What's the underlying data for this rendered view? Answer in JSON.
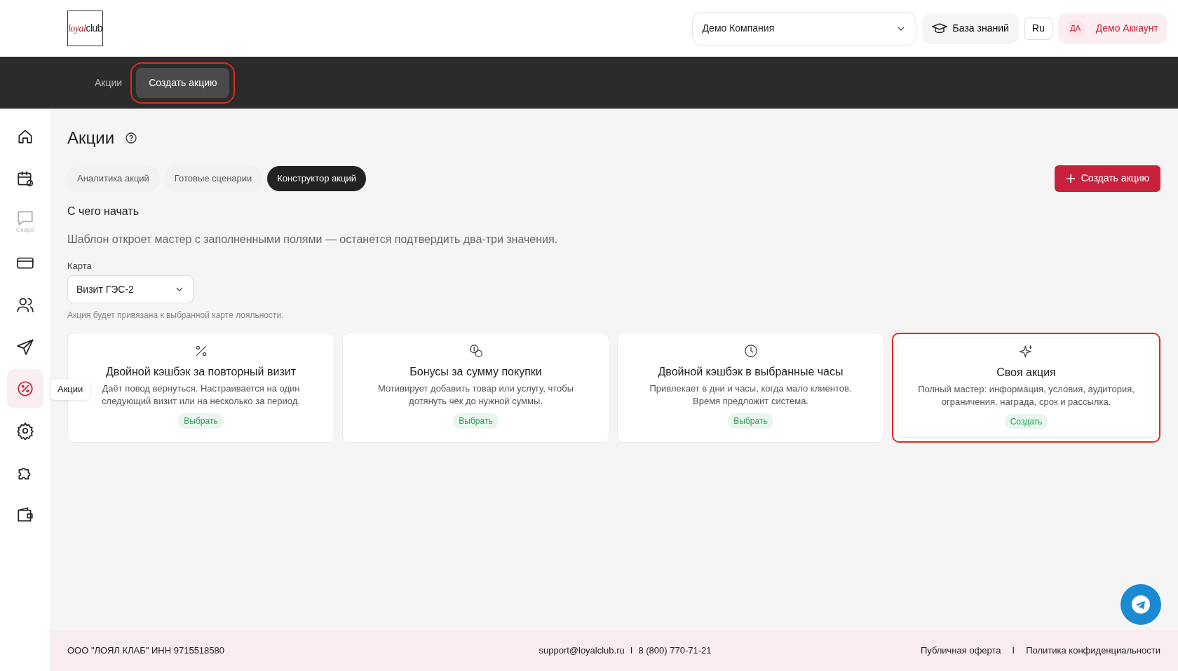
{
  "header": {
    "logo": {
      "accent": "loyal",
      "rest": "club"
    },
    "company_select": {
      "value": "Демо Компания"
    },
    "knowledge_base": "База знаний",
    "language": "Ru",
    "account": {
      "initials": "ДА",
      "name": "Демо Аккаунт"
    }
  },
  "subnav": [
    {
      "label": "Акции",
      "selected": false,
      "highlighted": false
    },
    {
      "label": "Создать акцию",
      "selected": true,
      "highlighted": true
    }
  ],
  "sidebar": {
    "items": [
      {
        "selected": false
      },
      {
        "selected": false
      },
      {
        "selected": false,
        "caption": "Скоро",
        "disabled": true
      },
      {
        "selected": false
      },
      {
        "selected": false
      },
      {
        "selected": false
      },
      {
        "selected": true
      },
      {
        "selected": false
      },
      {
        "selected": false
      },
      {
        "selected": false
      }
    ],
    "tooltip": "Акции"
  },
  "page": {
    "title": "Акции",
    "tabs": [
      {
        "label": "Аналитика акций",
        "selected": false
      },
      {
        "label": "Готовые сценарии",
        "selected": false
      },
      {
        "label": "Конструктор акций",
        "selected": true
      }
    ],
    "create_button": "Создать акцию",
    "section_title": "С чего начать",
    "description": "Шаблон откроет мастер с заполненными полями — останется подтвердить два-три значения.",
    "card_select": {
      "label": "Карта",
      "value": "Визит ГЭС-2",
      "hint": "Акция будет привязана к выбранной карте лояльности."
    },
    "templates": [
      {
        "title": "Двойной кэшбэк за повторный визит",
        "description": "Даёт повод вернуться. Настраивается на один следующий визит или на несколько за период.",
        "action": "Выбрать",
        "highlighted": false
      },
      {
        "title": "Бонусы за сумму покупки",
        "description": "Мотивирует добавить товар или услугу, чтобы дотянуть чек до нужной суммы.",
        "action": "Выбрать",
        "highlighted": false
      },
      {
        "title": "Двойной кэшбэк в выбранные часы",
        "description": "Привлекает в дни и часы, когда мало клиентов. Время предложит система.",
        "action": "Выбрать",
        "highlighted": false
      },
      {
        "title": "Своя акция",
        "description": "Полный мастер: информация, условия, аудитория, ограничения, награда, срок и рассылка.",
        "action": "Создать",
        "highlighted": true
      }
    ]
  },
  "footer": {
    "company": "ООО \"ЛОЯЛ КЛАБ\" ИНН 9715518580",
    "email": "support@loyalclub.ru",
    "separator_1": "I",
    "phone": "8 (800) 770-71-21",
    "offer": "Публичная оферта",
    "separator_2": "I",
    "privacy": "Политика конфиденциальности"
  }
}
